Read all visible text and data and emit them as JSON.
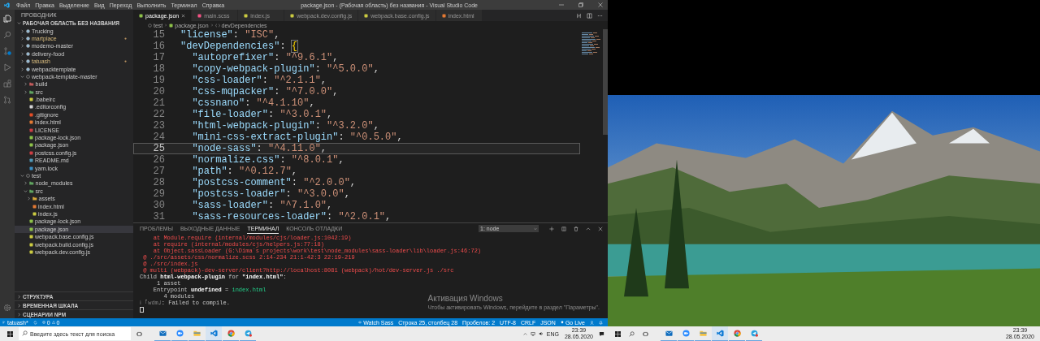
{
  "menu": [
    "Файл",
    "Правка",
    "Выделение",
    "Вид",
    "Переход",
    "Выполнить",
    "Терминал",
    "Справка"
  ],
  "title": "package.json - (Рабочая область) без названия - Visual Studio Code",
  "sidebar": {
    "header": "ПРОВОДНИК",
    "tree": [
      {
        "label": "РАБОЧАЯ ОБЛАСТЬ БЕЗ НАЗВАНИЯ",
        "kind": "root",
        "expanded": true,
        "selected": false,
        "modified": false,
        "children": [
          {
            "label": "Trucking",
            "kind": "project",
            "expanded": false,
            "selected": false,
            "modified": false
          },
          {
            "label": "martplace",
            "kind": "project",
            "expanded": false,
            "selected": false,
            "modified": true
          },
          {
            "label": "modemo-master",
            "kind": "project",
            "expanded": false,
            "selected": false,
            "modified": false
          },
          {
            "label": "delivery-food",
            "kind": "project",
            "expanded": false,
            "selected": false,
            "modified": false
          },
          {
            "label": "tatuash",
            "kind": "project",
            "expanded": false,
            "selected": false,
            "modified": true
          },
          {
            "label": "webpacktemplate",
            "kind": "project",
            "expanded": false,
            "selected": false,
            "modified": false
          },
          {
            "label": "webpack-template-master",
            "kind": "project",
            "expanded": true,
            "selected": false,
            "modified": false,
            "children": [
              {
                "label": "build",
                "kind": "folder",
                "color": "#c05a5a",
                "expanded": false,
                "selected": false,
                "modified": false
              },
              {
                "label": "src",
                "kind": "folder",
                "color": "#5fa35f",
                "expanded": false,
                "selected": false,
                "modified": false
              },
              {
                "label": ".babelrc",
                "kind": "file",
                "color": "#cbcb41",
                "selected": false,
                "modified": false
              },
              {
                "label": ".editorconfig",
                "kind": "file",
                "color": "#d4d4d4",
                "selected": false,
                "modified": false
              },
              {
                "label": ".gitignore",
                "kind": "file",
                "color": "#e44d26",
                "selected": false,
                "modified": false
              },
              {
                "label": "index.html",
                "kind": "file",
                "color": "#e37933",
                "selected": false,
                "modified": false
              },
              {
                "label": "LICENSE",
                "kind": "file",
                "color": "#cc3e44",
                "selected": false,
                "modified": false
              },
              {
                "label": "package-lock.json",
                "kind": "file",
                "color": "#8dc149",
                "selected": false,
                "modified": false
              },
              {
                "label": "package.json",
                "kind": "file",
                "color": "#8dc149",
                "selected": false,
                "modified": false
              },
              {
                "label": "postcss.config.js",
                "kind": "file",
                "color": "#cc3e44",
                "selected": false,
                "modified": false
              },
              {
                "label": "README.md",
                "kind": "file",
                "color": "#519aba",
                "selected": false,
                "modified": false
              },
              {
                "label": "yarn.lock",
                "kind": "file",
                "color": "#3b8fc4",
                "selected": false,
                "modified": false
              }
            ]
          },
          {
            "label": "test",
            "kind": "project",
            "expanded": true,
            "selected": false,
            "modified": false,
            "children": [
              {
                "label": "node_modules",
                "kind": "folder",
                "color": "#5fa35f",
                "expanded": false,
                "selected": false,
                "modified": false
              },
              {
                "label": "src",
                "kind": "folder",
                "color": "#5fa35f",
                "expanded": true,
                "selected": false,
                "modified": false,
                "children": [
                  {
                    "label": "assets",
                    "kind": "folder",
                    "color": "#d8a838",
                    "expanded": false,
                    "selected": false,
                    "modified": false
                  },
                  {
                    "label": "index.html",
                    "kind": "file",
                    "color": "#e37933",
                    "selected": false,
                    "modified": false
                  },
                  {
                    "label": "index.js",
                    "kind": "file",
                    "color": "#cbcb41",
                    "selected": false,
                    "modified": false
                  }
                ]
              },
              {
                "label": "package-lock.json",
                "kind": "file",
                "color": "#8dc149",
                "selected": false,
                "modified": false
              },
              {
                "label": "package.json",
                "kind": "file",
                "color": "#8dc149",
                "selected": true,
                "modified": false
              },
              {
                "label": "webpack.base.config.js",
                "kind": "file",
                "color": "#cbcb41",
                "selected": false,
                "modified": false
              },
              {
                "label": "webpack.build.config.js",
                "kind": "file",
                "color": "#cbcb41",
                "selected": false,
                "modified": false
              },
              {
                "label": "webpack.dev.config.js",
                "kind": "file",
                "color": "#cbcb41",
                "selected": false,
                "modified": false
              }
            ]
          }
        ]
      }
    ],
    "sections": [
      "СТРУКТУРА",
      "ВРЕМЕННАЯ ШКАЛА",
      "СЦЕНАРИИ NPM"
    ]
  },
  "tabs": [
    {
      "label": "package.json",
      "color": "#8dc149",
      "selected": true
    },
    {
      "label": "main.scss",
      "color": "#f55385",
      "selected": false
    },
    {
      "label": "index.js",
      "color": "#cbcb41",
      "selected": false
    },
    {
      "label": "webpack.dev.config.js",
      "color": "#cbcb41",
      "selected": false
    },
    {
      "label": "webpack.base.config.js",
      "color": "#cbcb41",
      "selected": false
    },
    {
      "label": "index.html",
      "color": "#e37933",
      "selected": false
    }
  ],
  "breadcrumb": [
    {
      "label": "test",
      "kind": "folder"
    },
    {
      "label": "package.json",
      "kind": "file"
    },
    {
      "label": "devDependencies",
      "kind": "symbol"
    }
  ],
  "editor": {
    "lines": [
      {
        "number": "15",
        "key": "\"license\"",
        "sep": ": ",
        "value": "\"ISC\"",
        "tail": ",",
        "current": false
      },
      {
        "number": "16",
        "key": "\"devDependencies\"",
        "sep": ": ",
        "tail": "{",
        "current": false,
        "children": [
          {
            "number": "17",
            "key": "\"autoprefixer\"",
            "sep": ": ",
            "value": "\"^9.6.1\"",
            "tail": ",",
            "current": false
          },
          {
            "number": "18",
            "key": "\"copy-webpack-plugin\"",
            "sep": ": ",
            "value": "\"^5.0.0\"",
            "tail": ",",
            "current": false
          },
          {
            "number": "19",
            "key": "\"css-loader\"",
            "sep": ": ",
            "value": "\"^2.1.1\"",
            "tail": ",",
            "current": false
          },
          {
            "number": "20",
            "key": "\"css-mqpacker\"",
            "sep": ": ",
            "value": "\"^7.0.0\"",
            "tail": ",",
            "current": false
          },
          {
            "number": "21",
            "key": "\"cssnano\"",
            "sep": ": ",
            "value": "\"^4.1.10\"",
            "tail": ",",
            "current": false
          },
          {
            "number": "22",
            "key": "\"file-loader\"",
            "sep": ": ",
            "value": "\"^3.0.1\"",
            "tail": ",",
            "current": false
          },
          {
            "number": "23",
            "key": "\"html-webpack-plugin\"",
            "sep": ": ",
            "value": "\"^3.2.0\"",
            "tail": ",",
            "current": false
          },
          {
            "number": "24",
            "key": "\"mini-css-extract-plugin\"",
            "sep": ": ",
            "value": "\"^0.5.0\"",
            "tail": ",",
            "current": false
          },
          {
            "number": "25",
            "key": "\"node-sass\"",
            "sep": ": ",
            "value": "\"^4.11.0\"",
            "tail": ",",
            "current": true
          },
          {
            "number": "26",
            "key": "\"normalize.css\"",
            "sep": ": ",
            "value": "\"^8.0.1\"",
            "tail": ",",
            "current": false
          },
          {
            "number": "27",
            "key": "\"path\"",
            "sep": ": ",
            "value": "\"^0.12.7\"",
            "tail": ",",
            "current": false
          },
          {
            "number": "28",
            "key": "\"postcss-comment\"",
            "sep": ": ",
            "value": "\"^2.0.0\"",
            "tail": ",",
            "current": false
          },
          {
            "number": "29",
            "key": "\"postcss-loader\"",
            "sep": ": ",
            "value": "\"^3.0.0\"",
            "tail": ",",
            "current": false
          },
          {
            "number": "30",
            "key": "\"sass-loader\"",
            "sep": ": ",
            "value": "\"^7.1.0\"",
            "tail": ",",
            "current": false
          },
          {
            "number": "31",
            "key": "\"sass-resources-loader\"",
            "sep": ": ",
            "value": "\"^2.0.1\"",
            "tail": ",",
            "current": false
          }
        ]
      }
    ]
  },
  "panel": {
    "tabs": [
      {
        "label": "ПРОБЛЕМЫ",
        "selected": false
      },
      {
        "label": "ВЫХОДНЫЕ ДАННЫЕ",
        "selected": false
      },
      {
        "label": "ТЕРМИНАЛ",
        "selected": true
      },
      {
        "label": "КОНСОЛЬ ОТЛАДКИ",
        "selected": false
      }
    ],
    "terminal_select": "1: node",
    "lines": [
      {
        "segments": [
          {
            "text": "    at Module.require (internal/modules/cjs/loader.js:1042:19)",
            "kind": "error"
          }
        ]
      },
      {
        "segments": [
          {
            "text": "    at require (internal/modules/cjs/helpers.js:77:18)",
            "kind": "error"
          }
        ]
      },
      {
        "segments": [
          {
            "text": "    at Object.sassLoader (G:\\Dima`s projects\\work\\test\\node_modules\\sass-loader\\lib\\loader.js:46:72)",
            "kind": "error"
          }
        ]
      },
      {
        "segments": [
          {
            "text": " @ ./src/assets/css/normalize.scss 2:14-234 21:1-42:3 22:19-219",
            "kind": "error"
          }
        ]
      },
      {
        "segments": [
          {
            "text": " @ ./src/index.js",
            "kind": "error"
          }
        ]
      },
      {
        "segments": [
          {
            "text": " @ multi (webpack)-dev-server/client?http://localhost:8081 (webpack)/hot/dev-server.js ./src",
            "kind": "error"
          }
        ]
      },
      {
        "segments": [
          {
            "text": "Child ",
            "kind": "normal"
          },
          {
            "text": "html-webpack-plugin",
            "kind": "bold"
          },
          {
            "text": " for ",
            "kind": "normal"
          },
          {
            "text": "\"index.html\"",
            "kind": "bold"
          },
          {
            "text": ":",
            "kind": "normal"
          }
        ]
      },
      {
        "segments": [
          {
            "text": "     1 asset",
            "kind": "normal"
          }
        ]
      },
      {
        "segments": [
          {
            "text": "    Entrypoint ",
            "kind": "normal"
          },
          {
            "text": "undefined",
            "kind": "bold"
          },
          {
            "text": " = ",
            "kind": "normal"
          },
          {
            "text": "index.html",
            "kind": "green"
          }
        ]
      },
      {
        "segments": [
          {
            "text": "       4 modules",
            "kind": "normal"
          }
        ]
      },
      {
        "segments": [
          {
            "text": "ℹ ｢wdm｣",
            "kind": "dim"
          },
          {
            "text": ": Failed to compile.",
            "kind": "normal"
          }
        ]
      }
    ]
  },
  "activation": {
    "title": "Активация Windows",
    "text": "Чтобы активировать Windows, перейдите в раздел \"Параметры\"."
  },
  "status_bar": {
    "branch": "tatuash*",
    "errors": "0",
    "warnings": "0",
    "items": [
      {
        "text": "Watch Sass",
        "kind": "watch"
      },
      {
        "text": "Строка 25, столбец 28",
        "kind": "plain"
      },
      {
        "text": "Пробелов: 2",
        "kind": "plain"
      },
      {
        "text": "UTF-8",
        "kind": "plain"
      },
      {
        "text": "CRLF",
        "kind": "plain"
      },
      {
        "text": "JSON",
        "kind": "plain"
      },
      {
        "text": "Go Live",
        "kind": "live"
      }
    ]
  },
  "taskbar_left": {
    "search_placeholder": "Введите здесь текст для поиска",
    "apps": [
      {
        "kind": "mail",
        "active": false
      },
      {
        "kind": "zoom",
        "active": false
      },
      {
        "kind": "explorer",
        "active": false
      },
      {
        "kind": "vscode",
        "active": true
      },
      {
        "kind": "chrome",
        "active": false
      },
      {
        "kind": "telegram",
        "active": false
      }
    ],
    "language": "ENG",
    "time": "23:39",
    "date": "28.05.2020"
  },
  "taskbar_right": {
    "apps": [
      {
        "kind": "mail",
        "active": false
      },
      {
        "kind": "zoom",
        "active": false
      },
      {
        "kind": "explorer",
        "active": false
      },
      {
        "kind": "vscode",
        "active": true
      },
      {
        "kind": "chrome",
        "active": false
      },
      {
        "kind": "telegram",
        "active": false
      }
    ],
    "time": "23:39",
    "date": "28.05.2020"
  }
}
